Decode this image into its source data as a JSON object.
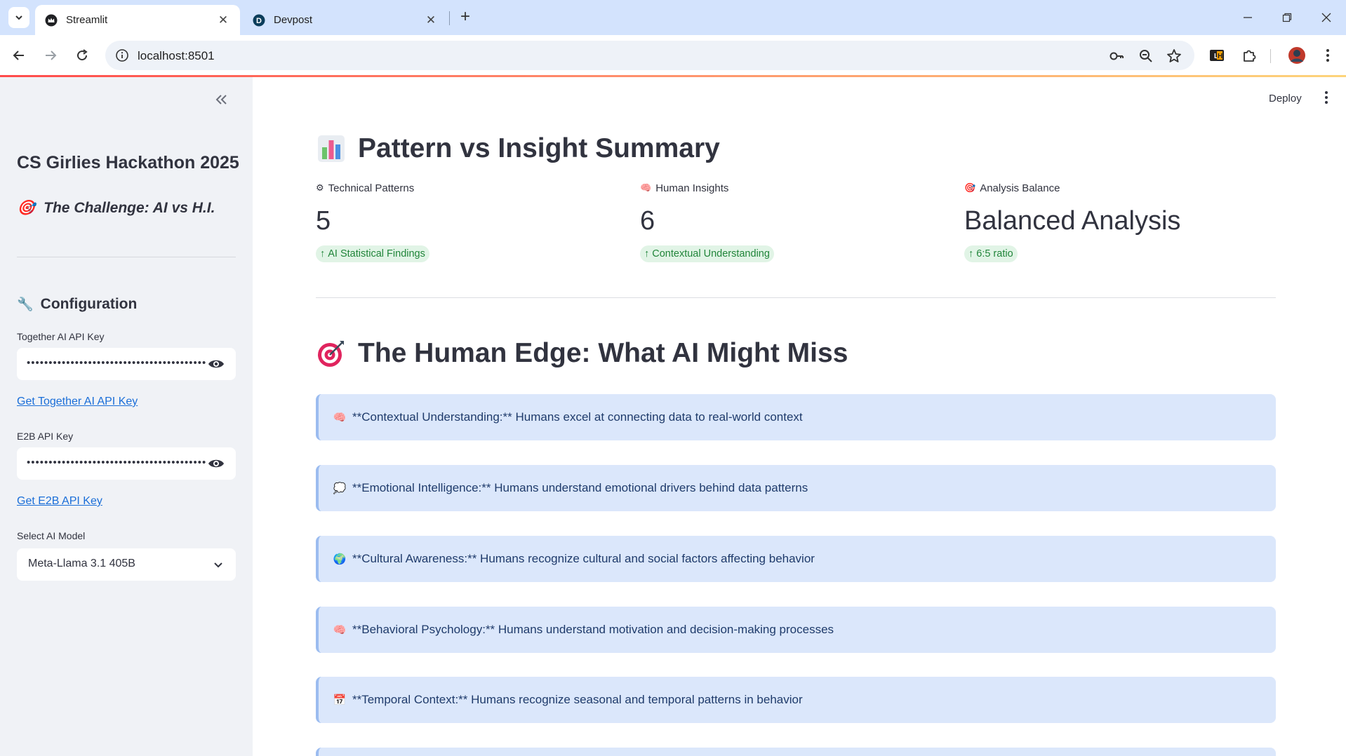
{
  "browser": {
    "tabs": [
      {
        "title": "Streamlit",
        "icon": "streamlit-crown-icon",
        "active": true
      },
      {
        "title": "Devpost",
        "icon": "devpost-d-icon",
        "active": false
      }
    ],
    "url": "localhost:8501"
  },
  "sidebar": {
    "title": "CS Girlies Hackathon 2025",
    "challenge": "The Challenge: AI vs H.I.",
    "challenge_emoji": "🎯",
    "config_heading": "Configuration",
    "config_emoji": "🔧",
    "together_label": "Together AI API Key",
    "together_value": "••••••••••••••••••••••••••••••••••••••••••••••",
    "together_link": "Get Together AI API Key",
    "e2b_label": "E2B API Key",
    "e2b_value": "••••••••••••••••••••••••••••••••••••••••••••••",
    "e2b_link": "Get E2B API Key",
    "model_label": "Select AI Model",
    "model_value": "Meta-Llama 3.1 405B"
  },
  "header": {
    "deploy_label": "Deploy"
  },
  "summary": {
    "heading": "Pattern vs Insight Summary",
    "metrics": [
      {
        "emoji": "⚙",
        "label": "Technical Patterns",
        "value": "5",
        "delta": "AI Statistical Findings"
      },
      {
        "emoji": "🧠",
        "label": "Human Insights",
        "value": "6",
        "delta": "Contextual Understanding"
      },
      {
        "emoji": "🎯",
        "label": "Analysis Balance",
        "value": "Balanced Analysis",
        "delta": "6:5 ratio"
      }
    ]
  },
  "edge": {
    "heading": "The Human Edge: What AI Might Miss",
    "items": [
      {
        "emoji": "🧠",
        "text": "**Contextual Understanding:** Humans excel at connecting data to real-world context"
      },
      {
        "emoji": "💭",
        "text": "**Emotional Intelligence:** Humans understand emotional drivers behind data patterns"
      },
      {
        "emoji": "🌍",
        "text": "**Cultural Awareness:** Humans recognize cultural and social factors affecting behavior"
      },
      {
        "emoji": "🧠",
        "text": "**Behavioral Psychology:** Humans understand motivation and decision-making processes"
      },
      {
        "emoji": "📅",
        "text": "**Temporal Context:** Humans recognize seasonal and temporal patterns in behavior"
      }
    ]
  },
  "colors": {
    "accent": "#ff4b4b",
    "sidebar_bg": "#f0f2f6",
    "info_bg": "#dbe7fb",
    "delta_bg": "#e1f4e6",
    "delta_text": "#21853a",
    "link": "#1a6ed8"
  }
}
